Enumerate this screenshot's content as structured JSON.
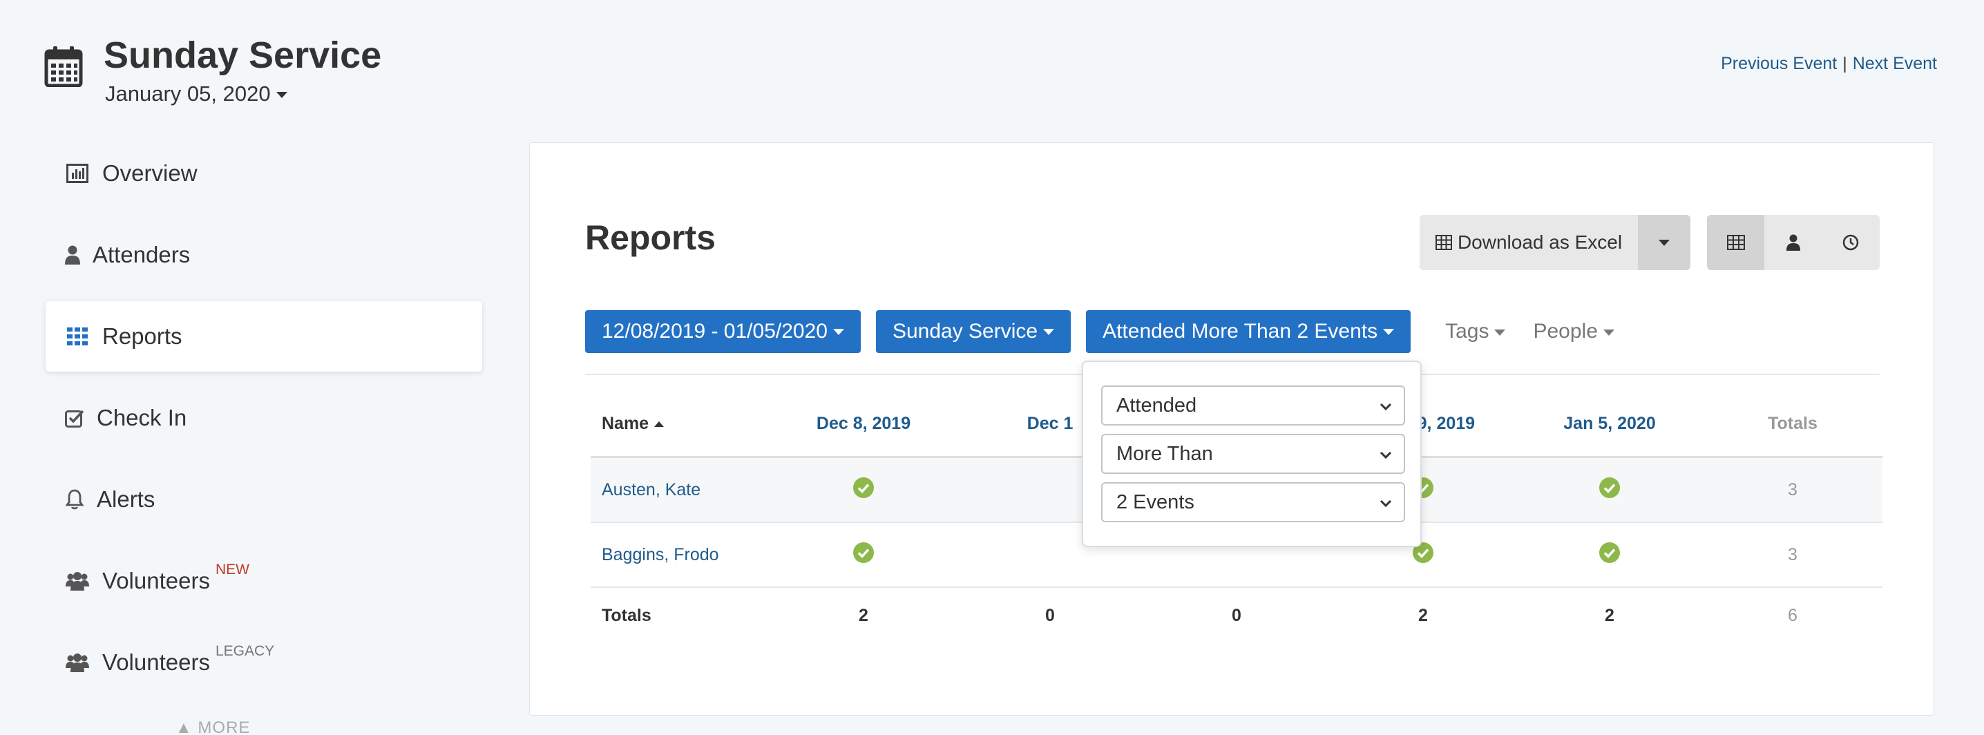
{
  "header": {
    "title": "Sunday Service",
    "date": "January 05, 2020",
    "prev_event": "Previous Event",
    "separator": "|",
    "next_event": "Next Event"
  },
  "sidebar": {
    "items": [
      {
        "label": "Overview",
        "icon": "bar-chart-icon"
      },
      {
        "label": "Attenders",
        "icon": "user-icon"
      },
      {
        "label": "Reports",
        "icon": "grid-icon",
        "active": true
      },
      {
        "label": "Check In",
        "icon": "checkbox-icon"
      },
      {
        "label": "Alerts",
        "icon": "bell-icon"
      },
      {
        "label": "Volunteers",
        "icon": "users-icon",
        "badge": "NEW"
      },
      {
        "label": "Volunteers",
        "icon": "users-icon",
        "badge": "LEGACY"
      }
    ],
    "more": "MORE"
  },
  "reports": {
    "title": "Reports",
    "download_label": "Download as Excel",
    "filters": {
      "date_range": "12/08/2019 - 01/05/2020",
      "event": "Sunday Service",
      "attendance": "Attended More Than 2 Events",
      "tags": "Tags",
      "people": "People"
    },
    "popover": {
      "select1": "Attended",
      "select2": "More Than",
      "select3": "2 Events"
    },
    "table": {
      "headers": {
        "name": "Name",
        "d1": "Dec 8, 2019",
        "d2": "Dec 1",
        "d4": "Dec 29, 2019",
        "d5": "Jan 5, 2020",
        "totals": "Totals"
      },
      "rows": [
        {
          "name": "Austen, Kate",
          "total": "3"
        },
        {
          "name": "Baggins, Frodo",
          "total": "3"
        }
      ],
      "footer": {
        "label": "Totals",
        "d1": "2",
        "d2": "0",
        "d3": "0",
        "d4": "2",
        "d5": "2",
        "total": "6"
      }
    }
  },
  "colors": {
    "primary": "#2371c4",
    "link": "#1f5b8c",
    "check": "#8db84a",
    "badge_new": "#c0392b"
  }
}
